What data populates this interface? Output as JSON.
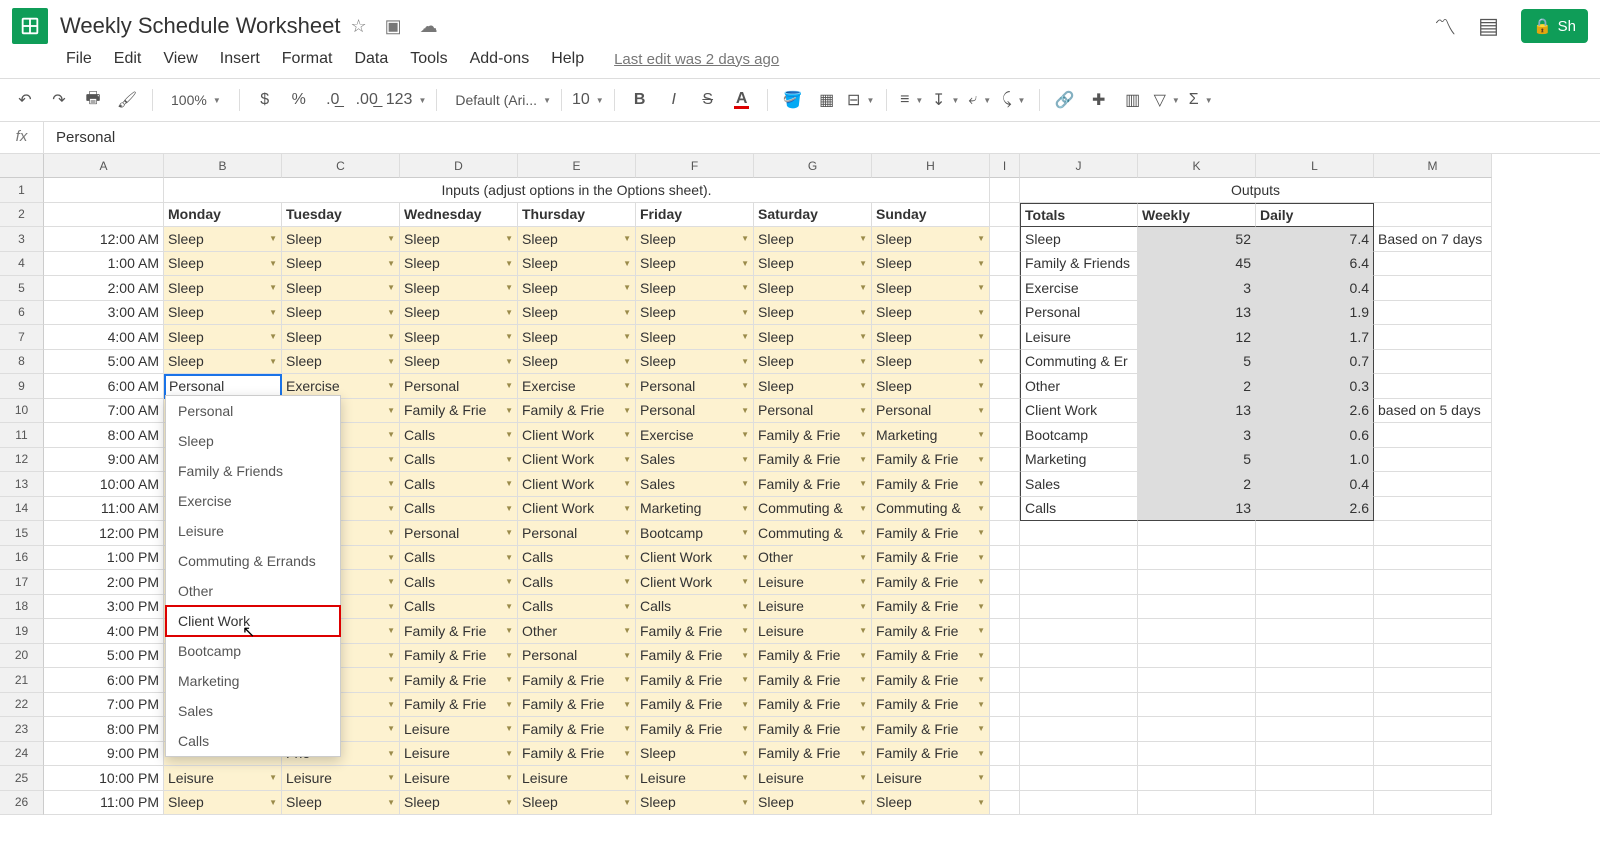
{
  "doc_title": "Weekly Schedule Worksheet",
  "menu": [
    "File",
    "Edit",
    "View",
    "Insert",
    "Format",
    "Data",
    "Tools",
    "Add-ons",
    "Help"
  ],
  "last_edit": "Last edit was 2 days ago",
  "toolbar": {
    "zoom": "100%",
    "font": "Default (Ari...",
    "fontsize": "10",
    "numfmt": "123"
  },
  "formula": "Personal",
  "share_label": "Sh",
  "col_letters": [
    "A",
    "B",
    "C",
    "D",
    "E",
    "F",
    "G",
    "H",
    "I",
    "J",
    "K",
    "L",
    "M"
  ],
  "row_nums_visible": 26,
  "row1": {
    "inputs_header": "Inputs (adjust options in the Options sheet).",
    "outputs_header": "Outputs"
  },
  "days": [
    "Monday",
    "Tuesday",
    "Wednesday",
    "Thursday",
    "Friday",
    "Saturday",
    "Sunday"
  ],
  "totals_hdr": [
    "Totals",
    "Weekly",
    "Daily"
  ],
  "times": [
    "12:00 AM",
    "1:00 AM",
    "2:00 AM",
    "3:00 AM",
    "4:00 AM",
    "5:00 AM",
    "6:00 AM",
    "7:00 AM",
    "8:00 AM",
    "9:00 AM",
    "10:00 AM",
    "11:00 AM",
    "12:00 PM",
    "1:00 PM",
    "2:00 PM",
    "3:00 PM",
    "4:00 PM",
    "5:00 PM",
    "6:00 PM",
    "7:00 PM",
    "8:00 PM",
    "9:00 PM",
    "10:00 PM",
    "11:00 PM"
  ],
  "schedule": [
    [
      "Sleep",
      "Sleep",
      "Sleep",
      "Sleep",
      "Sleep",
      "Sleep",
      "Sleep"
    ],
    [
      "Sleep",
      "Sleep",
      "Sleep",
      "Sleep",
      "Sleep",
      "Sleep",
      "Sleep"
    ],
    [
      "Sleep",
      "Sleep",
      "Sleep",
      "Sleep",
      "Sleep",
      "Sleep",
      "Sleep"
    ],
    [
      "Sleep",
      "Sleep",
      "Sleep",
      "Sleep",
      "Sleep",
      "Sleep",
      "Sleep"
    ],
    [
      "Sleep",
      "Sleep",
      "Sleep",
      "Sleep",
      "Sleep",
      "Sleep",
      "Sleep"
    ],
    [
      "Sleep",
      "Sleep",
      "Sleep",
      "Sleep",
      "Sleep",
      "Sleep",
      "Sleep"
    ],
    [
      "Personal",
      "Exercise",
      "Personal",
      "Exercise",
      "Personal",
      "Sleep",
      "Sleep"
    ],
    [
      "",
      "Frie",
      "Family & Frie",
      "Family & Frie",
      "Personal",
      "Personal",
      "Personal"
    ],
    [
      "",
      "ork",
      "Calls",
      "Client Work",
      "Exercise",
      "Family & Frie",
      "Marketing"
    ],
    [
      "",
      "",
      "Calls",
      "Client Work",
      "Sales",
      "Family & Frie",
      "Family & Frie"
    ],
    [
      "",
      "ork",
      "Calls",
      "Client Work",
      "Sales",
      "Family & Frie",
      "Family & Frie"
    ],
    [
      "",
      "ork",
      "Calls",
      "Client Work",
      "Marketing",
      "Commuting &",
      "Commuting &"
    ],
    [
      "",
      "",
      "Personal",
      "Personal",
      "Bootcamp",
      "Commuting &",
      "Family & Frie"
    ],
    [
      "",
      "p",
      "Calls",
      "Calls",
      "Client Work",
      "Other",
      "Family & Frie"
    ],
    [
      "",
      "p",
      "Calls",
      "Calls",
      "Client Work",
      "Leisure",
      "Family & Frie"
    ],
    [
      "",
      "",
      "Calls",
      "Calls",
      "Calls",
      "Leisure",
      "Family & Frie"
    ],
    [
      "",
      "",
      "Family & Frie",
      "Other",
      "Family & Frie",
      "Leisure",
      "Family & Frie"
    ],
    [
      "",
      "",
      "Family & Frie",
      "Personal",
      "Family & Frie",
      "Family & Frie",
      "Family & Frie"
    ],
    [
      "",
      "Frie",
      "Family & Frie",
      "Family & Frie",
      "Family & Frie",
      "Family & Frie",
      "Family & Frie"
    ],
    [
      "",
      "Frie",
      "Family & Frie",
      "Family & Frie",
      "Family & Frie",
      "Family & Frie",
      "Family & Frie"
    ],
    [
      "",
      "Frie",
      "Leisure",
      "Family & Frie",
      "Family & Frie",
      "Family & Frie",
      "Family & Frie"
    ],
    [
      "",
      "Frie",
      "Leisure",
      "Family & Frie",
      "Sleep",
      "Family & Frie",
      "Family & Frie"
    ],
    [
      "Leisure",
      "Leisure",
      "Leisure",
      "Leisure",
      "Leisure",
      "Leisure",
      "Leisure"
    ],
    [
      "Sleep",
      "Sleep",
      "Sleep",
      "Sleep",
      "Sleep",
      "Sleep",
      "Sleep"
    ]
  ],
  "totals": [
    {
      "label": "Sleep",
      "weekly": "52",
      "daily": "7.4",
      "note": "Based on 7 days"
    },
    {
      "label": "Family & Friends",
      "weekly": "45",
      "daily": "6.4",
      "note": ""
    },
    {
      "label": "Exercise",
      "weekly": "3",
      "daily": "0.4",
      "note": ""
    },
    {
      "label": "Personal",
      "weekly": "13",
      "daily": "1.9",
      "note": ""
    },
    {
      "label": "Leisure",
      "weekly": "12",
      "daily": "1.7",
      "note": ""
    },
    {
      "label": "Commuting & Er",
      "weekly": "5",
      "daily": "0.7",
      "note": ""
    },
    {
      "label": "Other",
      "weekly": "2",
      "daily": "0.3",
      "note": ""
    },
    {
      "label": "Client Work",
      "weekly": "13",
      "daily": "2.6",
      "note": "based on 5 days"
    },
    {
      "label": "Bootcamp",
      "weekly": "3",
      "daily": "0.6",
      "note": ""
    },
    {
      "label": "Marketing",
      "weekly": "5",
      "daily": "1.0",
      "note": ""
    },
    {
      "label": "Sales",
      "weekly": "2",
      "daily": "0.4",
      "note": ""
    },
    {
      "label": "Calls",
      "weekly": "13",
      "daily": "2.6",
      "note": ""
    }
  ],
  "dropdown": {
    "items": [
      "Personal",
      "Sleep",
      "Family & Friends",
      "Exercise",
      "Leisure",
      "Commuting & Errands",
      "Other",
      "Client Work",
      "Bootcamp",
      "Marketing",
      "Sales",
      "Calls"
    ],
    "highlighted_index": 7
  },
  "active_cell_value": "Personal"
}
